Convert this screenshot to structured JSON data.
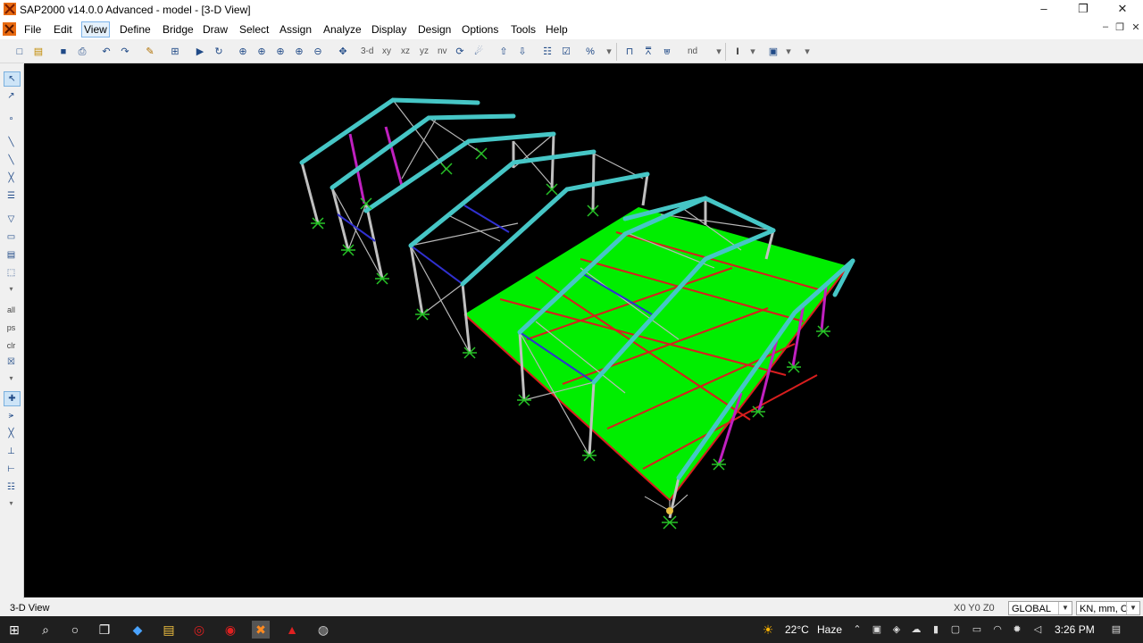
{
  "window": {
    "title": "SAP2000 v14.0.0 Advanced  - model - [3-D View]"
  },
  "menu": {
    "items": [
      "File",
      "Edit",
      "View",
      "Define",
      "Bridge",
      "Draw",
      "Select",
      "Assign",
      "Analyze",
      "Display",
      "Design",
      "Options",
      "Tools",
      "Help"
    ]
  },
  "toolbar": {
    "view_3d": "3-d",
    "view_xy": "xy",
    "view_xz": "xz",
    "view_yz": "yz",
    "view_nv": "nv",
    "nd": "nd"
  },
  "left_toolbar": {
    "all": "all",
    "ps": "ps",
    "clr": "clr"
  },
  "viewport": {
    "label": "3-D View"
  },
  "status": {
    "view_name": "3-D View",
    "coords": "X0  Y0  Z0",
    "coord_system": "GLOBAL",
    "units": "KN, mm, C"
  },
  "taskbar": {
    "weather_temp": "22°C",
    "weather_desc": "Haze",
    "time": "3:26 PM"
  },
  "colors": {
    "viewport_bg": "#000000",
    "slab": "#00ee00",
    "rafter": "#46c6c6",
    "bracing": "#c0c0c0",
    "purlin": "#d81e1e",
    "magenta_brace": "#c020c0",
    "support": "#27c427"
  }
}
